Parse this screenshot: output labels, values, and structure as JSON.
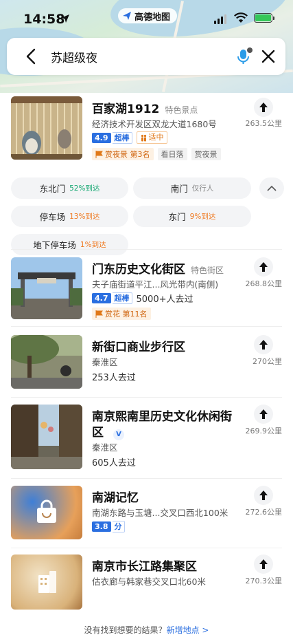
{
  "status": {
    "time": "14:58",
    "app_name": "高德地图"
  },
  "search": {
    "query": "苏超级夜"
  },
  "results": [
    {
      "title": "百家湖1912",
      "category": "特色景点",
      "address": "经济技术开发区双龙大道1680号",
      "rating": "4.9",
      "rating_tag": "超棒",
      "crowd_tag": "适中",
      "rank_label": "赏夜景 第3名",
      "chips": [
        "看日落",
        "赏夜景"
      ],
      "distance": "263.5公里",
      "entrances": [
        {
          "name": "东北门",
          "pct": "52%到达"
        },
        {
          "name": "南门",
          "pct": "仅行人"
        },
        {
          "name": "停车场",
          "pct": "13%到达"
        },
        {
          "name": "东门",
          "pct": "9%到达"
        },
        {
          "name": "地下停车场",
          "pct": "1%到达"
        }
      ]
    },
    {
      "title": "门东历史文化街区",
      "category": "特色街区",
      "address": "夫子庙街道平江...风光带内(南侧)",
      "rating": "4.7",
      "rating_tag": "超棒",
      "visits": "5000+人去过",
      "rank_label": "赏花 第11名",
      "distance": "268.8公里"
    },
    {
      "title": "新街口商业步行区",
      "address": "秦淮区",
      "visits": "253人去过",
      "distance": "270公里"
    },
    {
      "title": "南京熙南里历史文化休闲街",
      "title_line2": "区",
      "verified": "V",
      "address": "秦淮区",
      "visits": "605人去过",
      "distance": "269.9公里"
    },
    {
      "title": "南湖记忆",
      "address": "南湖东路与玉塘...交叉口西北100米",
      "rating": "3.8",
      "rating_tag": "分",
      "distance": "272.6公里"
    },
    {
      "title": "南京市长江路集聚区",
      "address": "估衣廊与韩家巷交叉口北60米",
      "distance": "270.3公里"
    }
  ],
  "footer": {
    "text": "没有找到想要的结果？",
    "link": "新增地点 >"
  },
  "colors": {
    "accent": "#2b6fe0",
    "orange": "#e07818",
    "green": "#19a974"
  }
}
